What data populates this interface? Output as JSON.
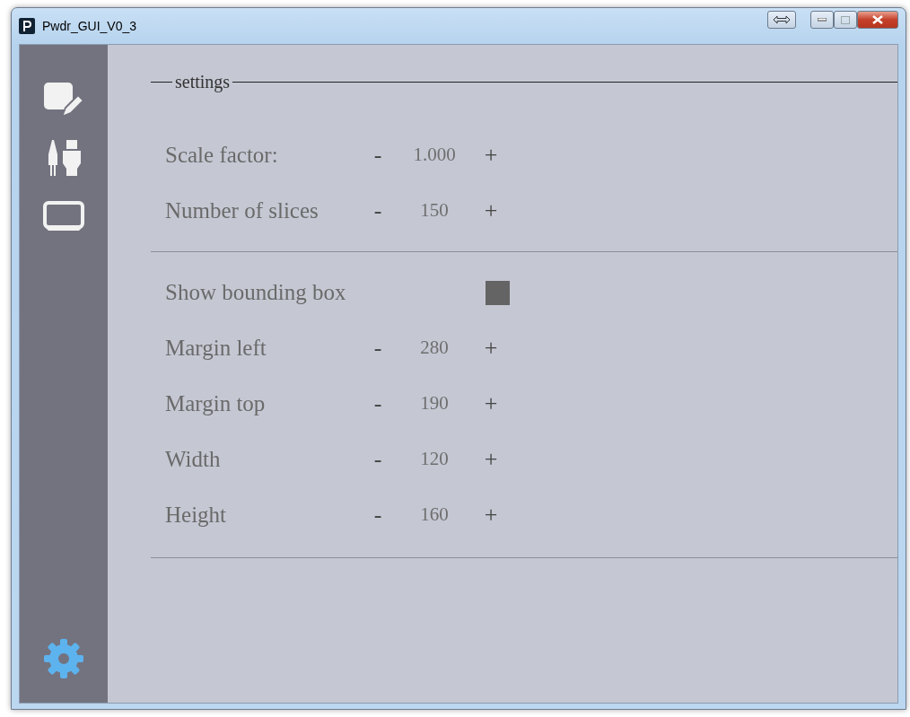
{
  "window": {
    "title": "Pwdr_GUI_V0_3"
  },
  "sidebar": {
    "items": [
      {
        "kind": "edit",
        "selected": false
      },
      {
        "kind": "plugs",
        "selected": false
      },
      {
        "kind": "screen",
        "selected": false
      },
      {
        "kind": "settings",
        "selected": true
      }
    ]
  },
  "sections": [
    {
      "title": "settings",
      "rows": [
        {
          "kind": "stepper",
          "label": "Scale factor:",
          "minus": "-",
          "value": "1.000",
          "plus": "+"
        },
        {
          "kind": "stepper",
          "label": "Number of slices",
          "minus": "-",
          "value": "150",
          "plus": "+"
        }
      ]
    },
    {
      "rows": [
        {
          "kind": "checkbox",
          "label": "Show bounding box",
          "checked": true
        },
        {
          "kind": "stepper",
          "label": "Margin left",
          "minus": "-",
          "value": "280",
          "plus": "+"
        },
        {
          "kind": "stepper",
          "label": "Margin top",
          "minus": "-",
          "value": "190",
          "plus": "+"
        },
        {
          "kind": "stepper",
          "label": "Width",
          "minus": "-",
          "value": "120",
          "plus": "+"
        },
        {
          "kind": "stepper",
          "label": "Height",
          "minus": "-",
          "value": "160",
          "plus": "+"
        }
      ]
    }
  ]
}
